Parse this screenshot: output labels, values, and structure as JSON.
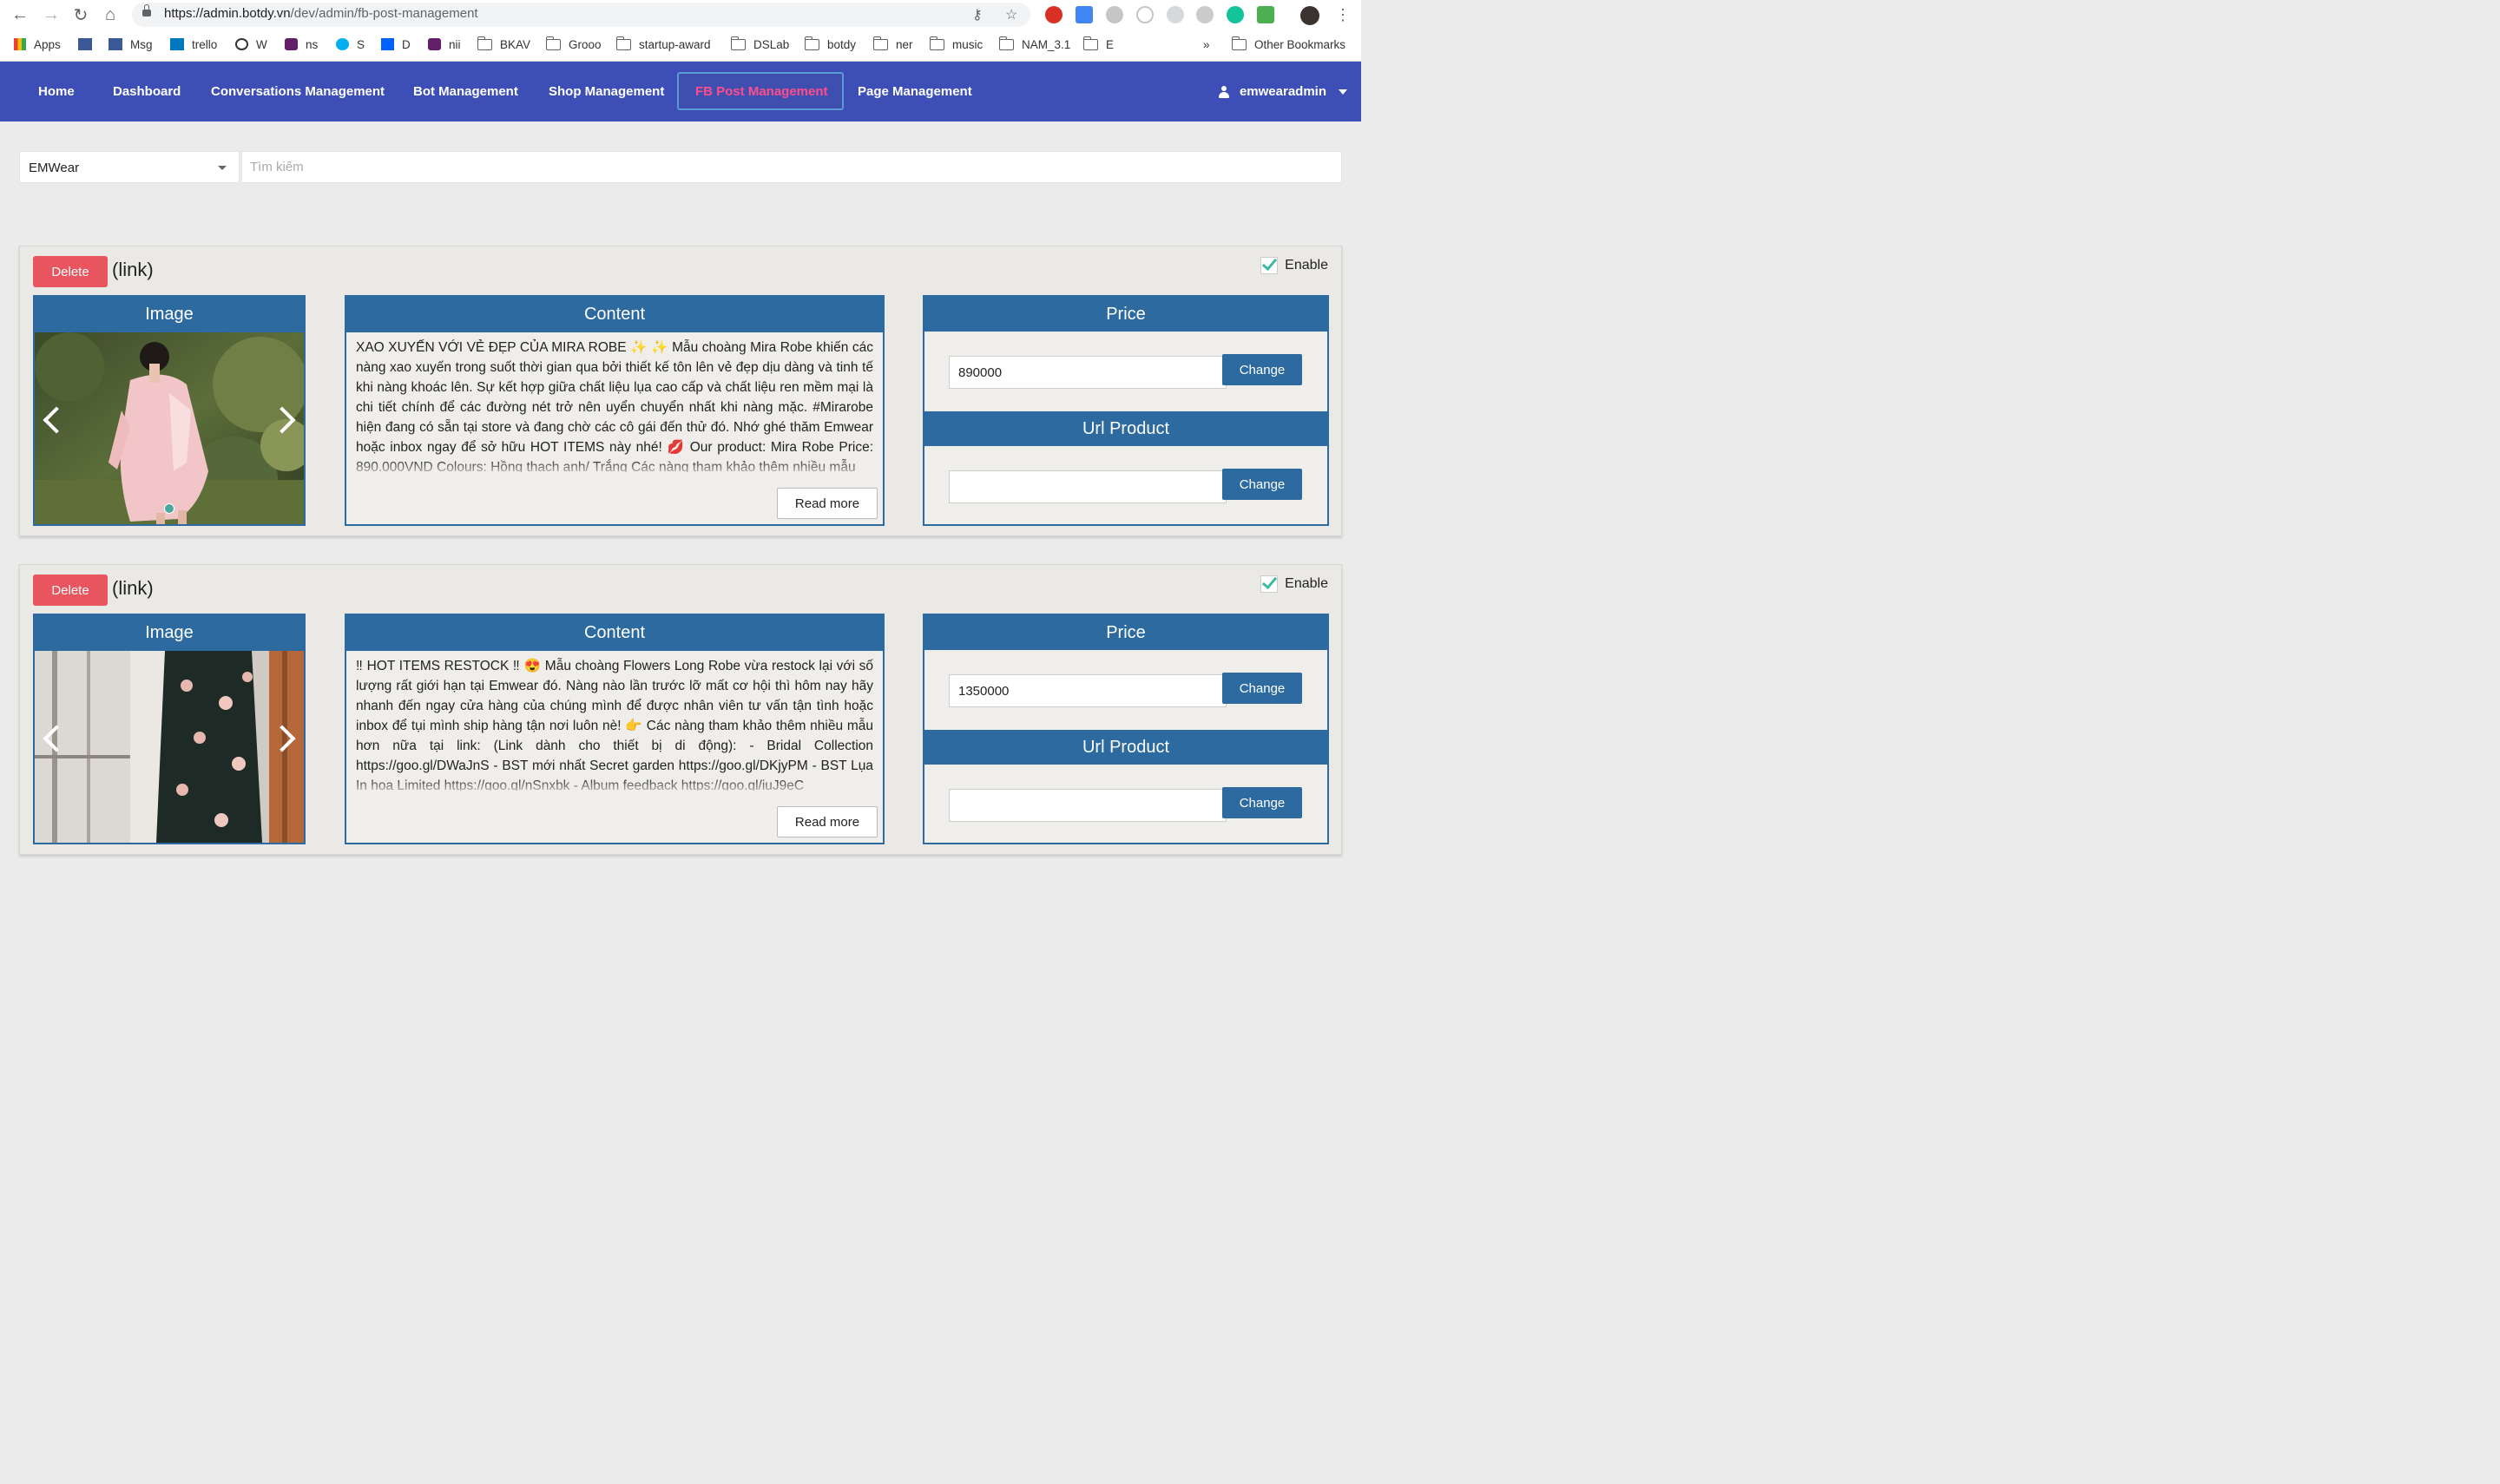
{
  "browser": {
    "url_host": "https://admin.botdy.vn",
    "url_path": "/dev/admin/fb-post-management",
    "bookmarks": [
      "Apps",
      "Msg",
      "trello",
      "W",
      "ns",
      "S",
      "D",
      "nii",
      "BKAV",
      "Grooo",
      "startup-award",
      "DSLab",
      "botdy",
      "ner",
      "music",
      "NAM_3.1",
      "E"
    ],
    "overflow": "»",
    "other_bookmarks": "Other Bookmarks"
  },
  "navbar": {
    "items": [
      "Home",
      "Dashboard",
      "Conversations Management",
      "Bot Management",
      "Shop Management",
      "FB Post Management",
      "Page Management"
    ],
    "active_index": 5,
    "user": "emwearadmin"
  },
  "filters": {
    "shop_selected": "EMWear",
    "search_placeholder": "Tìm kiếm"
  },
  "labels": {
    "delete": "Delete",
    "link": "(link)",
    "enable": "Enable",
    "image": "Image",
    "content": "Content",
    "price": "Price",
    "url_product": "Url Product",
    "change": "Change",
    "read_more": "Read more"
  },
  "posts": [
    {
      "enabled": true,
      "content": "XAO XUYẾN VỚI VẺ ĐẸP CỦA MIRA ROBE ✨ ✨ Mẫu choàng Mira Robe khiến các nàng xao xuyến trong suốt thời gian qua bởi thiết kế tôn lên vẻ đẹp dịu dàng và tinh tế khi nàng khoác lên. Sự kết hợp giữa chất liệu lụa cao cấp và chất liệu ren mềm mại là chi tiết chính để các đường nét trở nên uyển chuyển nhất khi nàng mặc. #Mirarobe hiện đang có sẵn tại store và đang chờ các cô gái đến thử đó. Nhớ ghé thăm Emwear hoặc inbox ngay để sở hữu HOT ITEMS này nhé! 💋 Our product: Mira Robe Price: 890.000VND Colours: Hồng thạch anh/ Trắng Các nàng tham khảo thêm nhiều mẫu",
      "price": "890000",
      "url_product": ""
    },
    {
      "enabled": true,
      "content": "‼ HOT ITEMS RESTOCK ‼ 😍 Mẫu choàng Flowers Long Robe vừa restock lại với số lượng rất giới hạn tại Emwear đó. Nàng nào lần trước lỡ mất cơ hội thì hôm nay hãy nhanh đến ngay cửa hàng của chúng mình để được nhân viên tư vấn tận tình hoặc inbox để tụi mình ship hàng tận nơi luôn nè! 👉 Các nàng tham khảo thêm nhiều mẫu hơn nữa tại link: (Link dành cho thiết bị di động): - Bridal Collection https://goo.gl/DWaJnS - BST mới nhất Secret garden https://goo.gl/DKjyPM - BST Lụa In hoa Limited https://goo.gl/nSnxbk - Album feedback https://goo.gl/iuJ9eC",
      "price": "1350000",
      "url_product": ""
    }
  ],
  "colors": {
    "navbar": "#3d4fb7",
    "active_nav": "#ff4d8b",
    "panel_header": "#2d6a9f",
    "delete": "#e9555e",
    "check": "#3db9a3"
  }
}
